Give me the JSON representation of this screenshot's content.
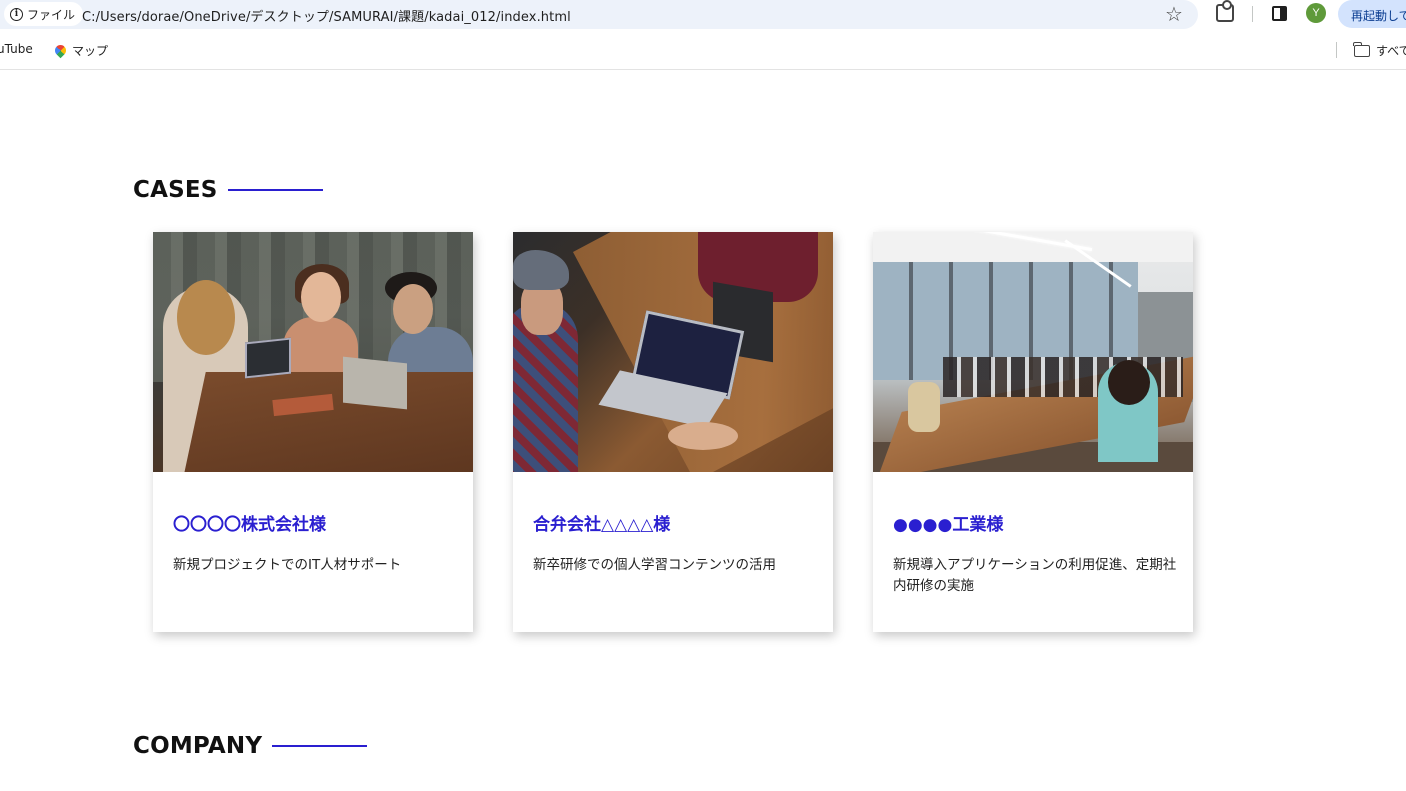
{
  "browser": {
    "site_chip_label": "ファイル",
    "url": "C:/Users/dorae/OneDrive/デスクトップ/SAMURAI/課題/kadai_012/index.html",
    "avatar_letter": "Y",
    "relaunch_label": "再起動して更新",
    "bookmarks": [
      {
        "label": "uTube",
        "icon": "youtube-icon"
      },
      {
        "label": "マップ",
        "icon": "maps-icon"
      }
    ],
    "all_bookmarks_label": "すべて"
  },
  "sections": {
    "cases_title": "CASES",
    "company_title": "COMPANY"
  },
  "cases": [
    {
      "title": "〇〇〇〇株式会社様",
      "description": "新規プロジェクトでのIT人材サポート",
      "image": "photo-team-cafe"
    },
    {
      "title": "合弁会社△△△△様",
      "description": "新卒研修での個人学習コンテンツの活用",
      "image": "photo-laptop-meeting"
    },
    {
      "title": "●●●●工業様",
      "description": "新規導入アプリケーションの利用促進、定期社内研修の実施",
      "image": "photo-conference-room"
    }
  ],
  "colors": {
    "accent": "#2a1fd0",
    "heading": "#111111",
    "body_text": "#222222"
  }
}
